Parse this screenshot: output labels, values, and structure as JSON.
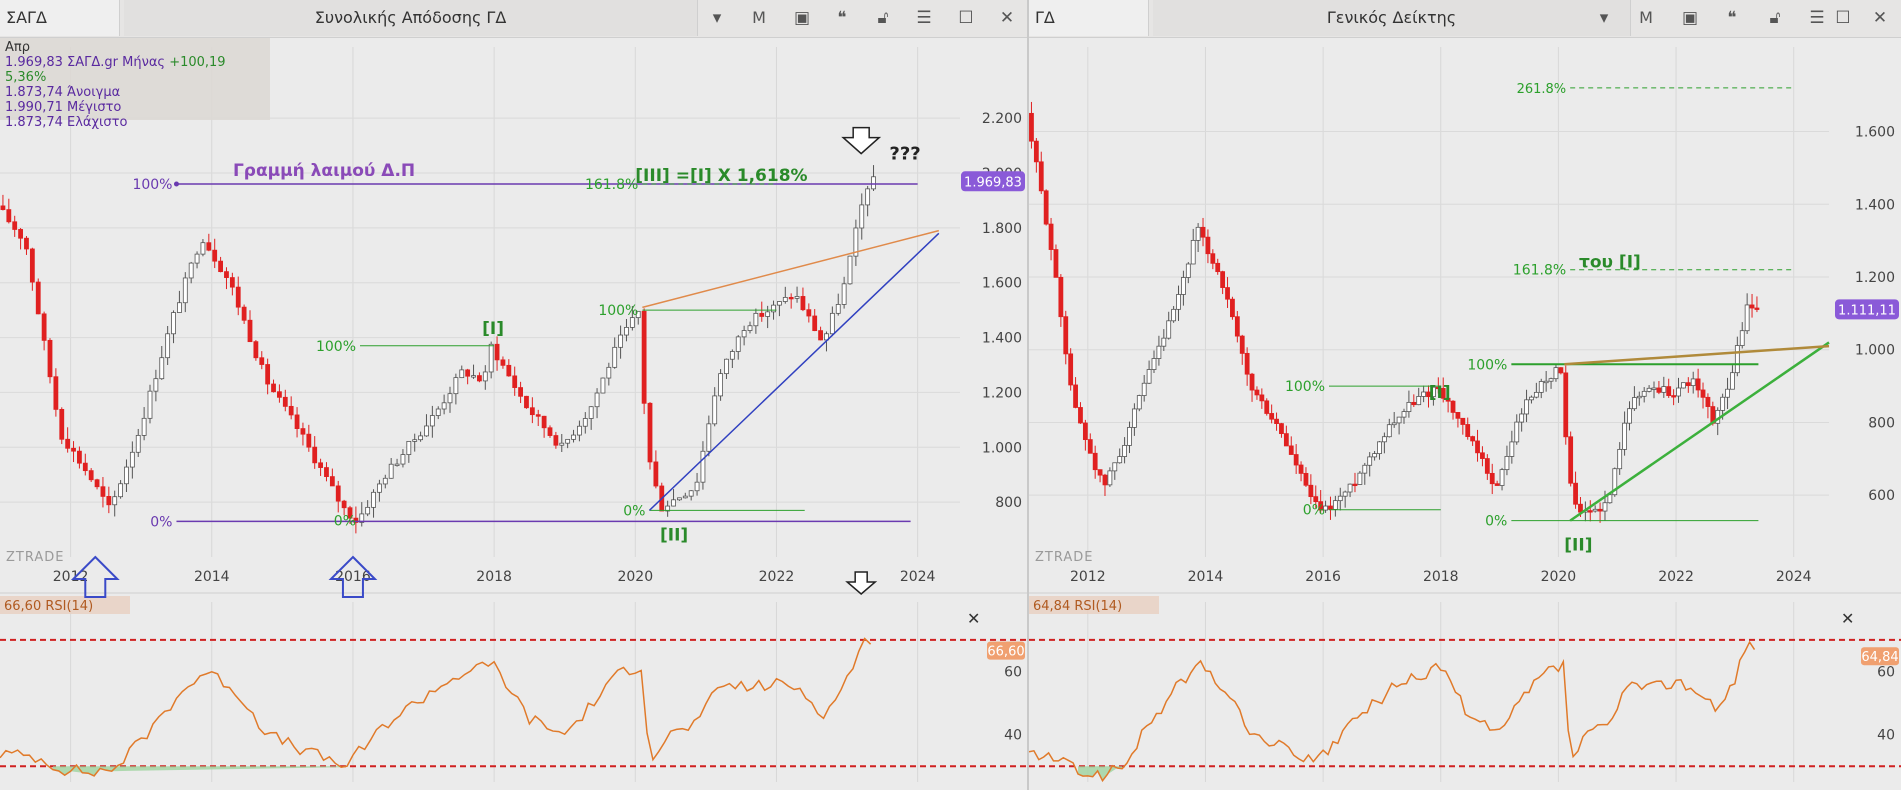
{
  "left": {
    "symbol": "ΣΑΓΔ",
    "title": "Συνολικής Απόδοσης ΓΔ",
    "toolbar_m": "M",
    "info": {
      "period": "Απρ",
      "line1_a": "1.969,83 ΣΑΓΔ.gr Μήνας",
      "line1_b": "+100,19 5,36%",
      "line2": "1.873,74 Άνοιγμα",
      "line3": "1.990,71 Μέγιστο",
      "line4": "1.873,74 Ελάχιστο"
    },
    "watermark": "ZTRADE",
    "annotations": {
      "neckline": "Γραμμή λαιμού Δ.Π",
      "wave3": "[III] =[I] X 1,618%",
      "question": "???",
      "w1": "[I]",
      "w2": "[II]",
      "p100a": "100%",
      "p0a": "0%",
      "p100b": "100%",
      "p0b": "0%",
      "p100c": "100%",
      "p1618": "161.8%",
      "p0c": "0%"
    },
    "price_badge": "1.969,83",
    "rsi_label": "66,60 RSI(14)",
    "rsi_badge": "66,60"
  },
  "right": {
    "symbol": "ΓΔ",
    "title": "Γενικός Δείκτης",
    "toolbar_m": "M",
    "watermark": "ZTRADE",
    "annotations": {
      "fib_label": "του [I]",
      "p1618": "161.8%",
      "p2618": "261.8%",
      "w1": "[I]",
      "w2": "[II]",
      "p100a": "100%",
      "p100b": "100%",
      "p0a": "0%",
      "p0b": "0%"
    },
    "price_badge": "1.111,11",
    "rsi_label": "64,84 RSI(14)",
    "rsi_badge": "64,84"
  },
  "colors": {
    "up": "#ffffff",
    "down": "#e02020",
    "rsi": "#e07a2a",
    "purple": "#6a3ab0",
    "green": "#2ca02c",
    "blue": "#3040c0",
    "dashed_red": "#d02020"
  },
  "chart_data": [
    {
      "type": "candlestick",
      "title": "Συνολικής Απόδοσης ΓΔ",
      "interval": "monthly",
      "x_ticks": [
        "2012",
        "2014",
        "2016",
        "2018",
        "2020",
        "2022",
        "2024"
      ],
      "y_ticks": [
        "800",
        "1.000",
        "1.200",
        "1.400",
        "1.600",
        "1.800",
        "2.000",
        "2.200"
      ],
      "ylim": [
        600,
        2350
      ],
      "xlim": [
        2011.0,
        2024.6
      ],
      "last_close": 1969.83,
      "anchors": [
        [
          2011.0,
          1880
        ],
        [
          2011.4,
          1750
        ],
        [
          2011.9,
          1050
        ],
        [
          2012.3,
          900
        ],
        [
          2012.6,
          770
        ],
        [
          2013.0,
          1050
        ],
        [
          2013.5,
          1480
        ],
        [
          2013.9,
          1770
        ],
        [
          2014.3,
          1600
        ],
        [
          2014.8,
          1250
        ],
        [
          2015.3,
          1050
        ],
        [
          2015.9,
          780
        ],
        [
          2016.1,
          730
        ],
        [
          2016.5,
          900
        ],
        [
          2017.2,
          1120
        ],
        [
          2017.6,
          1280
        ],
        [
          2017.9,
          1240
        ],
        [
          2018.0,
          1370
        ],
        [
          2018.5,
          1150
        ],
        [
          2019.0,
          1000
        ],
        [
          2019.4,
          1140
        ],
        [
          2019.8,
          1380
        ],
        [
          2020.1,
          1500
        ],
        [
          2020.2,
          1000
        ],
        [
          2020.4,
          780
        ],
        [
          2020.9,
          860
        ],
        [
          2021.2,
          1240
        ],
        [
          2021.6,
          1450
        ],
        [
          2022.0,
          1510
        ],
        [
          2022.3,
          1560
        ],
        [
          2022.7,
          1380
        ],
        [
          2023.0,
          1590
        ],
        [
          2023.25,
          1880
        ],
        [
          2023.35,
          1970
        ]
      ],
      "rsi": {
        "label": "RSI(14)",
        "last": 66.6,
        "ylim": [
          25,
          82
        ],
        "y_ticks": [
          "40",
          "60"
        ],
        "anchors": [
          [
            2011.0,
            34
          ],
          [
            2011.5,
            33
          ],
          [
            2011.9,
            29
          ],
          [
            2012.3,
            28
          ],
          [
            2012.6,
            29
          ],
          [
            2013.0,
            38
          ],
          [
            2013.5,
            52
          ],
          [
            2013.9,
            60
          ],
          [
            2014.3,
            55
          ],
          [
            2014.8,
            40
          ],
          [
            2015.3,
            35
          ],
          [
            2015.9,
            30
          ],
          [
            2016.5,
            44
          ],
          [
            2017.2,
            55
          ],
          [
            2017.6,
            60
          ],
          [
            2018.0,
            62
          ],
          [
            2018.5,
            45
          ],
          [
            2019.0,
            40
          ],
          [
            2019.4,
            50
          ],
          [
            2019.8,
            60
          ],
          [
            2020.1,
            62
          ],
          [
            2020.2,
            32
          ],
          [
            2020.5,
            40
          ],
          [
            2020.9,
            44
          ],
          [
            2021.2,
            56
          ],
          [
            2021.6,
            55
          ],
          [
            2022.0,
            56
          ],
          [
            2022.3,
            55
          ],
          [
            2022.7,
            46
          ],
          [
            2023.0,
            58
          ],
          [
            2023.25,
            70
          ],
          [
            2023.35,
            66.6
          ]
        ]
      }
    },
    {
      "type": "candlestick",
      "title": "Γενικός Δείκτης",
      "interval": "monthly",
      "x_ticks": [
        "2012",
        "2014",
        "2016",
        "2018",
        "2020",
        "2022",
        "2024"
      ],
      "y_ticks": [
        "600",
        "800",
        "1.000",
        "1.200",
        "1.400",
        "1.600"
      ],
      "ylim": [
        430,
        1750
      ],
      "xlim": [
        2011.0,
        2024.6
      ],
      "last_close": 1111.11,
      "anchors": [
        [
          2011.0,
          1650
        ],
        [
          2011.4,
          1300
        ],
        [
          2011.8,
          850
        ],
        [
          2012.3,
          620
        ],
        [
          2012.6,
          720
        ],
        [
          2013.0,
          900
        ],
        [
          2013.5,
          1100
        ],
        [
          2013.9,
          1330
        ],
        [
          2014.3,
          1200
        ],
        [
          2014.8,
          900
        ],
        [
          2015.3,
          780
        ],
        [
          2015.9,
          570
        ],
        [
          2016.1,
          560
        ],
        [
          2016.5,
          620
        ],
        [
          2017.2,
          800
        ],
        [
          2017.6,
          860
        ],
        [
          2018.0,
          900
        ],
        [
          2018.5,
          760
        ],
        [
          2019.0,
          620
        ],
        [
          2019.4,
          830
        ],
        [
          2019.8,
          920
        ],
        [
          2020.1,
          950
        ],
        [
          2020.2,
          650
        ],
        [
          2020.4,
          540
        ],
        [
          2020.9,
          580
        ],
        [
          2021.2,
          840
        ],
        [
          2021.6,
          900
        ],
        [
          2022.0,
          880
        ],
        [
          2022.3,
          920
        ],
        [
          2022.7,
          800
        ],
        [
          2023.0,
          940
        ],
        [
          2023.25,
          1120
        ],
        [
          2023.35,
          1111
        ]
      ],
      "rsi": {
        "label": "RSI(14)",
        "last": 64.84,
        "ylim": [
          25,
          82
        ],
        "y_ticks": [
          "40",
          "60"
        ],
        "anchors": [
          [
            2011.0,
            34
          ],
          [
            2011.5,
            32
          ],
          [
            2011.9,
            28
          ],
          [
            2012.3,
            27
          ],
          [
            2012.6,
            30
          ],
          [
            2013.0,
            42
          ],
          [
            2013.5,
            55
          ],
          [
            2013.9,
            62
          ],
          [
            2014.3,
            55
          ],
          [
            2014.8,
            40
          ],
          [
            2015.3,
            36
          ],
          [
            2015.9,
            31
          ],
          [
            2016.5,
            44
          ],
          [
            2017.2,
            55
          ],
          [
            2017.6,
            58
          ],
          [
            2018.0,
            62
          ],
          [
            2018.5,
            45
          ],
          [
            2019.0,
            40
          ],
          [
            2019.4,
            52
          ],
          [
            2019.8,
            60
          ],
          [
            2020.1,
            62
          ],
          [
            2020.2,
            32
          ],
          [
            2020.5,
            40
          ],
          [
            2020.9,
            44
          ],
          [
            2021.2,
            56
          ],
          [
            2021.6,
            55
          ],
          [
            2022.0,
            57
          ],
          [
            2022.3,
            55
          ],
          [
            2022.7,
            47
          ],
          [
            2023.0,
            58
          ],
          [
            2023.25,
            71
          ],
          [
            2023.35,
            64.8
          ]
        ]
      }
    }
  ]
}
